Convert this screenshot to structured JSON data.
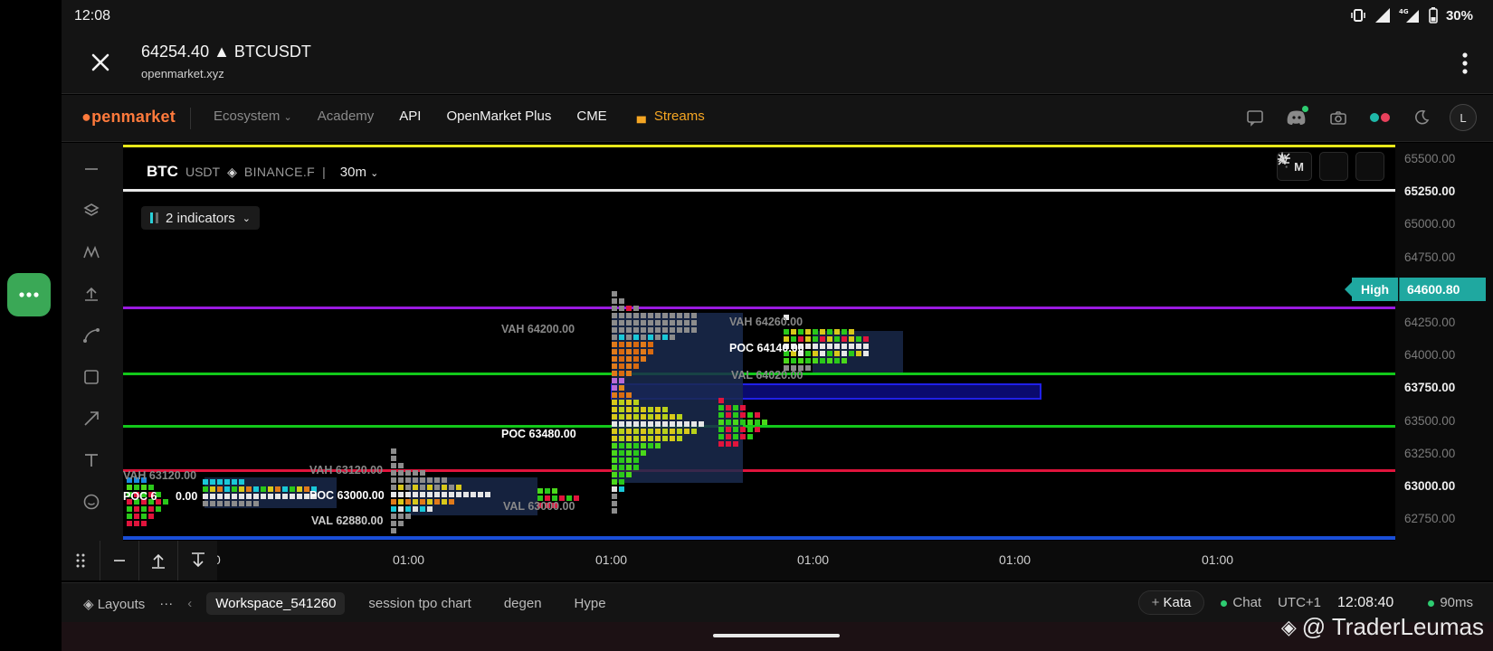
{
  "status": {
    "time": "12:08",
    "battery": "30%",
    "network": "4G"
  },
  "browser": {
    "title": "64254.40 ▲ BTCUSDT",
    "url": "openmarket.xyz"
  },
  "nav": {
    "logo": "penmarket",
    "items": [
      {
        "label": "Ecosystem",
        "style": "dim"
      },
      {
        "label": "Academy",
        "style": "dim"
      },
      {
        "label": "API",
        "style": "bright"
      },
      {
        "label": "OpenMarket Plus",
        "style": "bright"
      },
      {
        "label": "CME",
        "style": "bright"
      },
      {
        "label": "Streams",
        "style": "stream"
      }
    ],
    "avatar": "L"
  },
  "chart": {
    "base": "BTC",
    "quote": "USDT",
    "exchange": "BINANCE.F",
    "separator": "|",
    "timeframe": "30m",
    "indicators": "2 indicators",
    "mode_button": "M",
    "high_label": "High",
    "high_value": "64600.80",
    "y_ticks": [
      "65500.00",
      "65250.00",
      "65000.00",
      "64750.00",
      "64600.80",
      "64250.00",
      "64000.00",
      "63750.00",
      "63500.00",
      "63250.00",
      "63000.00",
      "62750.00"
    ],
    "y_bold": [
      "65250.00",
      "63750.00",
      "63000.00"
    ],
    "x_ticks": [
      "0",
      "01:00",
      "01:00",
      "01:00",
      "01:00",
      "01:00"
    ],
    "labels": {
      "vah1": "VAH 63120.00",
      "poc1": "POC 6",
      "poc1b": "0.00",
      "vah2": "VAH 63120.00",
      "poc2": "POC 63000.00",
      "val2": "VAL 62880.00",
      "vah3": "VAH 64200.00",
      "poc3": "POC 63480.00",
      "val3": "VAL 63000.00",
      "vah4": "VAH 64260.00",
      "poc4": "POC 64140.00",
      "val4": "VAL 64020.00"
    },
    "colors": {
      "yellow_line": "#e8e81a",
      "white_line": "#e8e8e8",
      "purple_line": "#9a1ae0",
      "green_line": "#12c81a",
      "red_line": "#e0143c",
      "blue_line": "#1a4fd8",
      "high_tag": "#1fa8a0"
    }
  },
  "footer": {
    "layouts": "Layouts",
    "more": "···",
    "tabs": [
      "Workspace_541260",
      "session tpo chart",
      "degen",
      "Hype"
    ],
    "kata": "Kata",
    "chat": "Chat",
    "timezone": "UTC+1",
    "clock": "12:08:40",
    "latency": "90ms"
  },
  "watermark": "@ TraderLeumas"
}
